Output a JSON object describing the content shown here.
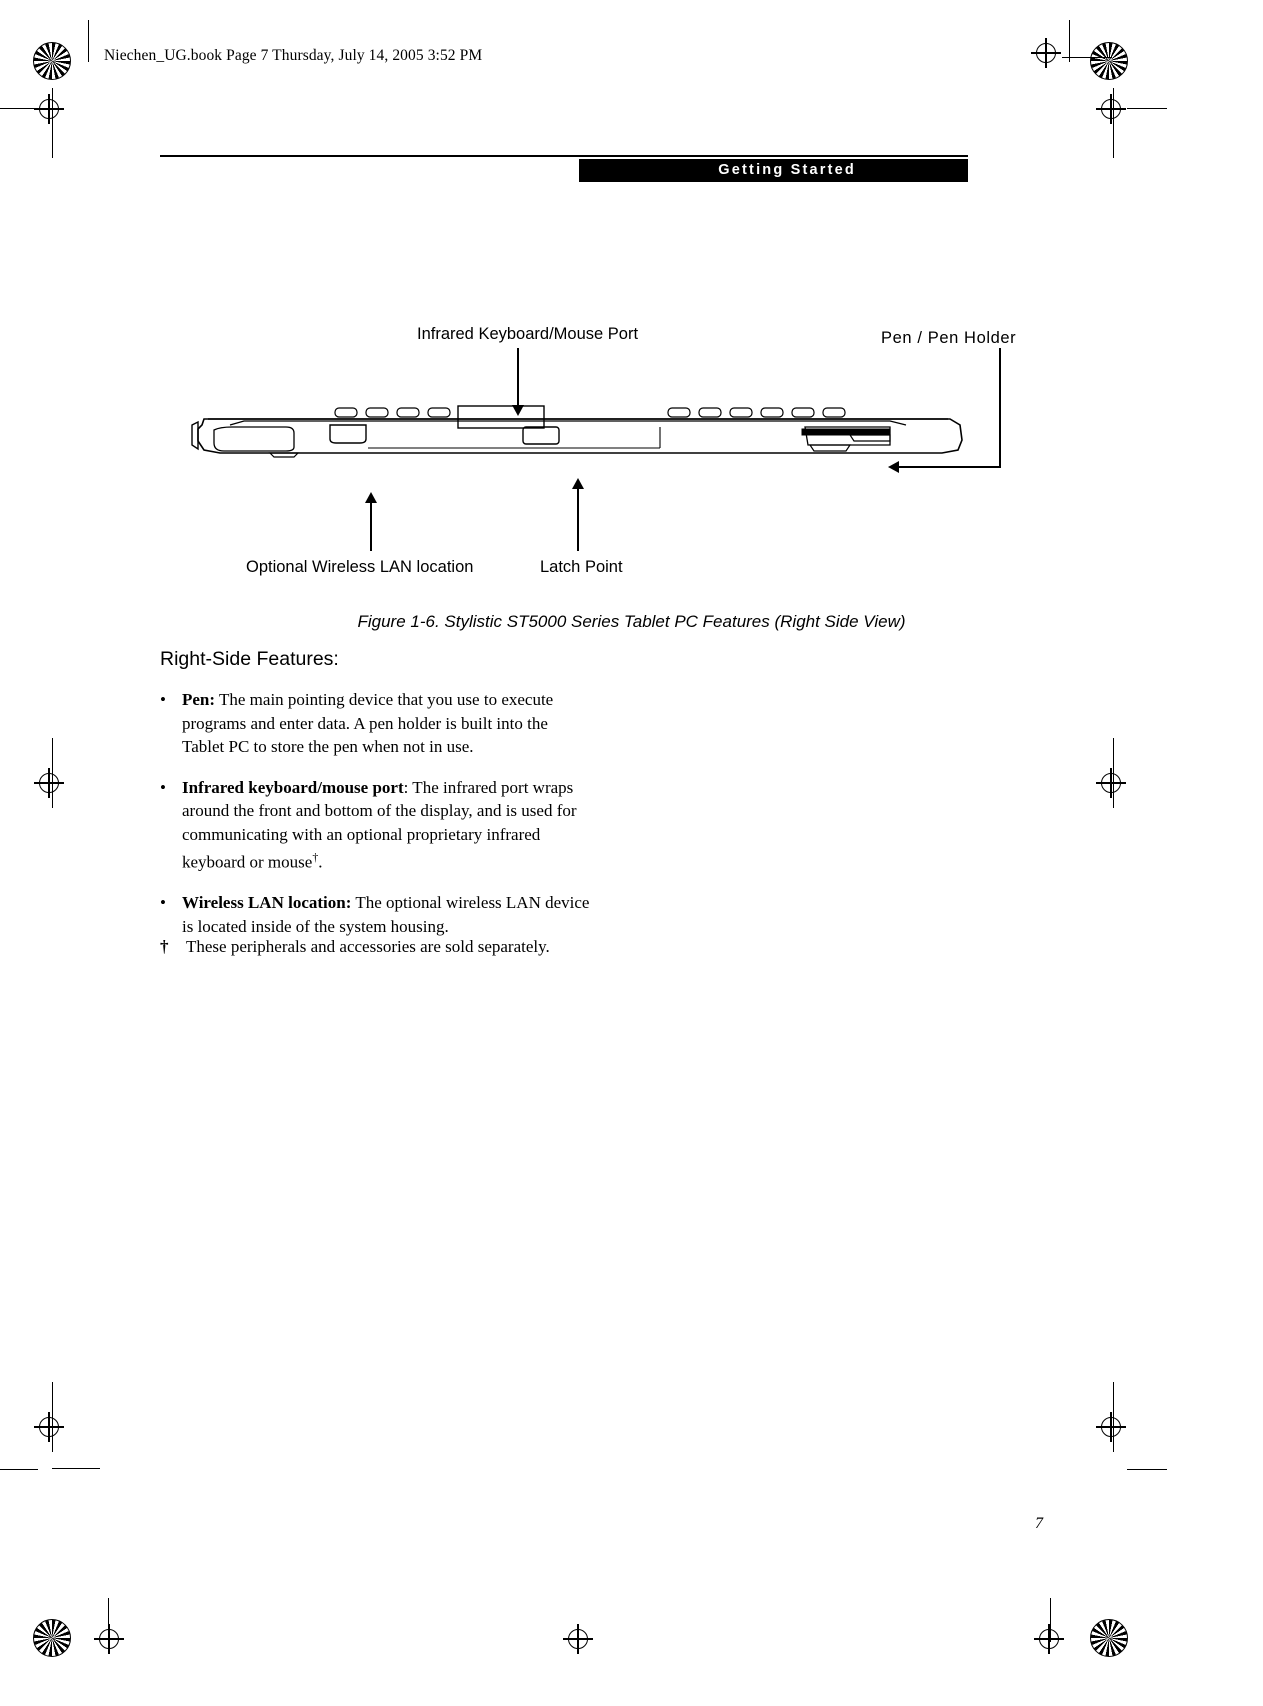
{
  "header": {
    "book_line": "Niechen_UG.book  Page 7  Thursday, July 14, 2005  3:52 PM",
    "chapter_tab": "Getting Started"
  },
  "figure": {
    "labels": {
      "infrared_port": "Infrared Keyboard/Mouse Port",
      "pen_holder": "Pen / Pen Holder",
      "wireless_lan": "Optional Wireless LAN location",
      "latch_point": "Latch Point"
    },
    "caption": "Figure 1-6. Stylistic ST5000 Series Tablet PC Features (Right Side View)"
  },
  "body": {
    "heading": "Right-Side Features:",
    "bullet_mark": "•",
    "bullets": [
      {
        "term": "Pen:",
        "text": " The main pointing device that you use to execute programs and enter data. A pen holder is built into the Tablet PC to store the pen when not in use."
      },
      {
        "term": "Infrared keyboard/mouse port",
        "text": ": The infrared port wraps around the front and bottom of the display, and is used for communicating with an optional proprietary infrared keyboard or mouse",
        "suffix": "."
      },
      {
        "term": "Wireless LAN location:",
        "text": " The optional wireless LAN device is located inside of the system housing."
      }
    ],
    "footnote_mark": "†",
    "footnote_text": "These peripherals and accessories are sold separately."
  },
  "page_number": "7"
}
